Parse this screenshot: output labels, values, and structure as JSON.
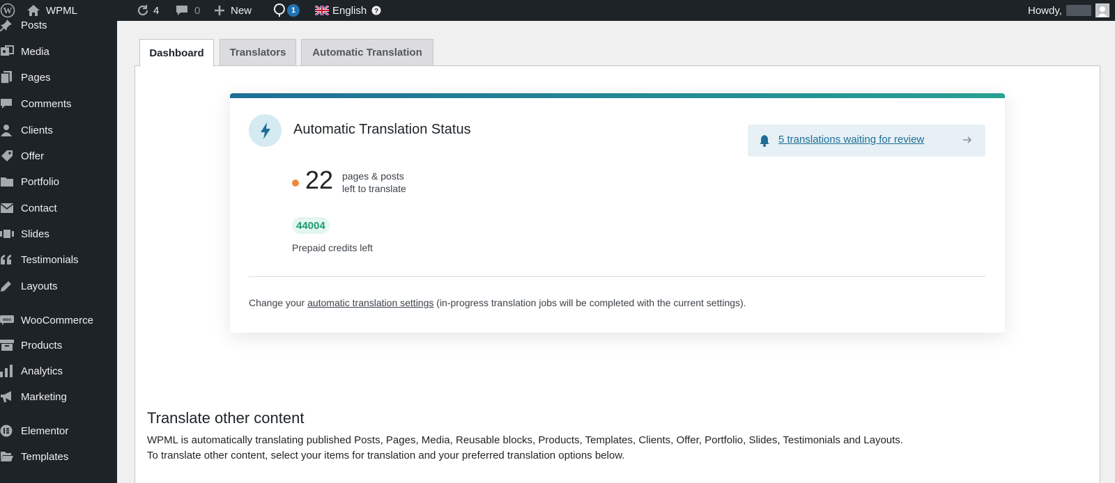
{
  "adminbar": {
    "site_name": "WPML",
    "updates_count": "4",
    "comments_count": "0",
    "new_label": "New",
    "notification_count": "1",
    "language_label": "English",
    "howdy_text": "Howdy,"
  },
  "sidebar": {
    "items": [
      {
        "label": "Posts",
        "icon": "pin-icon"
      },
      {
        "label": "Media",
        "icon": "media-icon"
      },
      {
        "label": "Pages",
        "icon": "pages-icon"
      },
      {
        "label": "Comments",
        "icon": "comment-icon"
      },
      {
        "label": "Clients",
        "icon": "users-icon"
      },
      {
        "label": "Offer",
        "icon": "tag-icon"
      },
      {
        "label": "Portfolio",
        "icon": "folder-icon"
      },
      {
        "label": "Contact",
        "icon": "mail-icon"
      },
      {
        "label": "Slides",
        "icon": "slides-icon"
      },
      {
        "label": "Testimonials",
        "icon": "quote-icon"
      },
      {
        "label": "Layouts",
        "icon": "edit-icon"
      },
      {
        "label": "WooCommerce",
        "icon": "woo-icon"
      },
      {
        "label": "Products",
        "icon": "archive-icon"
      },
      {
        "label": "Analytics",
        "icon": "chart-bar-icon"
      },
      {
        "label": "Marketing",
        "icon": "megaphone-icon"
      },
      {
        "label": "Elementor",
        "icon": "elementor-icon"
      },
      {
        "label": "Templates",
        "icon": "folder-open-icon"
      }
    ]
  },
  "tabs": [
    {
      "label": "Dashboard",
      "active": true
    },
    {
      "label": "Translators",
      "active": false
    },
    {
      "label": "Automatic Translation",
      "active": false
    }
  ],
  "status_card": {
    "title": "Automatic Translation Status",
    "review_link": "5 translations waiting for review",
    "remaining_count": "22",
    "remaining_desc_line1": "pages & posts",
    "remaining_desc_line2": "left to translate",
    "credits_value": "44004",
    "credits_label": "Prepaid credits left",
    "settings_prefix": "Change your ",
    "settings_link": "automatic translation settings",
    "settings_suffix": " (in-progress translation jobs will be completed with the current settings).",
    "colors": {
      "accent_start": "#1f6e96",
      "accent_end": "#27a193",
      "pending_dot": "#f0863c",
      "credits_text": "#1d9a75"
    }
  },
  "other_content": {
    "title": "Translate other content",
    "line1": "WPML is automatically translating published Posts, Pages, Media, Reusable blocks, Products, Templates, Clients, Offer, Portfolio, Slides, Testimonials and Layouts.",
    "line2": "To translate other content, select your items for translation and your preferred translation options below."
  }
}
